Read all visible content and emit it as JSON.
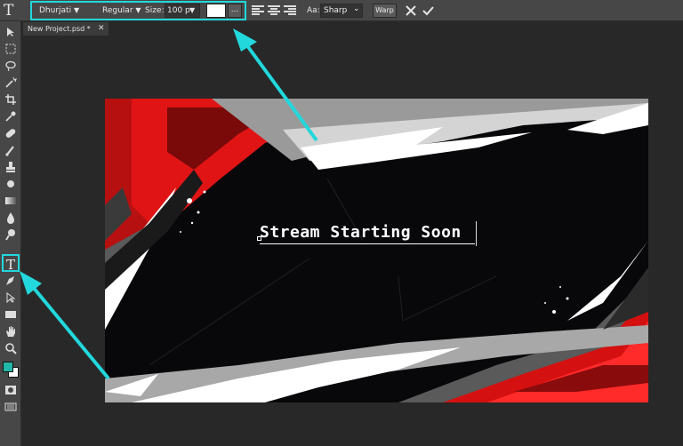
{
  "options_bar": {
    "tool_icon": "type-tool-icon",
    "font_family": "Dhurjati",
    "font_style": "Regular",
    "size_label": "Size:",
    "size_value": "100 p",
    "color_hex": "#ffffff",
    "more_label": "...",
    "antialias_label": "Aa:",
    "antialias_value": "Sharp",
    "warp_label": "Warp",
    "dropdown_glyph": "▼",
    "select_glyph": "⌄"
  },
  "document": {
    "tab_title": "New Project.psd *",
    "close_glyph": "✕"
  },
  "canvas": {
    "text": "Stream Starting Soon"
  },
  "toolbar": {
    "tools": [
      "move-tool-icon",
      "marquee-tool-icon",
      "lasso-tool-icon",
      "magic-wand-icon",
      "crop-tool-icon",
      "eyedropper-icon",
      "healing-brush-icon",
      "brush-icon",
      "clone-stamp-icon",
      "eraser-icon",
      "gradient-icon",
      "blur-icon",
      "dodge-icon",
      "type-tool-icon",
      "pen-tool-icon",
      "path-select-icon",
      "shape-tool-icon",
      "hand-tool-icon",
      "zoom-tool-icon"
    ],
    "foreground_color": "#22b5a8",
    "background_color": "#ffffff"
  },
  "annotations": {
    "arrow_color": "#22d8dc"
  }
}
